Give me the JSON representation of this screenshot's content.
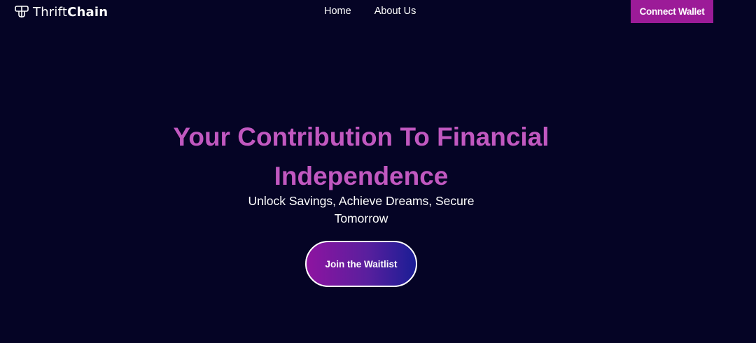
{
  "brand": {
    "name_light": "Thrift",
    "name_bold": "Chain",
    "icon": "thriftchain-logo-icon"
  },
  "nav": {
    "items": [
      {
        "label": "Home"
      },
      {
        "label": "About Us"
      }
    ]
  },
  "header": {
    "connect_label": "Connect Wallet"
  },
  "hero": {
    "title_line1": "Your Contribution To Financial",
    "title_line2": "Independence",
    "subtitle_line1": "Unlock Savings, Achieve Dreams, Secure",
    "subtitle_line2": "Tomorrow",
    "cta_label": "Join the Waitlist"
  },
  "colors": {
    "background": "#050425",
    "accent": "#c158c0",
    "button_purple": "#9c1b98",
    "gradient_start": "#8e14a0",
    "gradient_end": "#1a1d95"
  }
}
